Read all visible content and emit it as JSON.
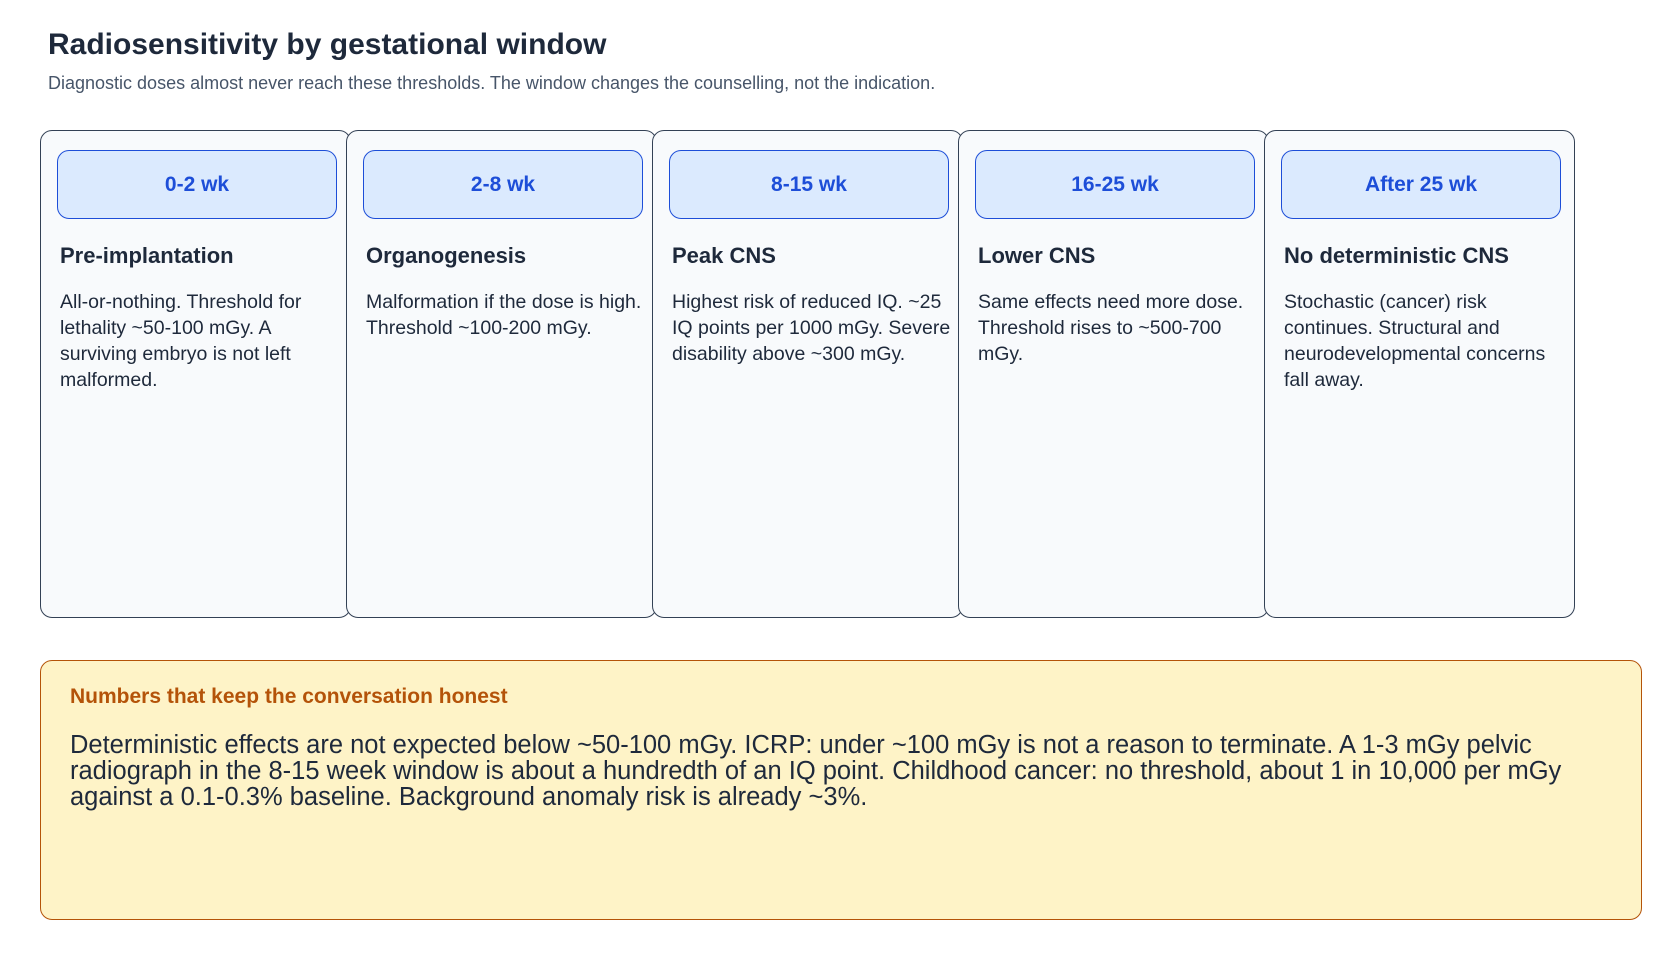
{
  "header": {
    "title": "Radiosensitivity by gestational window",
    "subtitle": "Diagnostic doses almost never reach these thresholds. The window changes the counselling, not the indication."
  },
  "windows": [
    {
      "tab": "0-2 wk",
      "heading": "Pre-implantation",
      "body": "All-or-nothing. Threshold for lethality ~50-100 mGy. A surviving embryo is not left malformed."
    },
    {
      "tab": "2-8 wk",
      "heading": "Organogenesis",
      "body": "Malformation if the dose is high. Threshold ~100-200 mGy."
    },
    {
      "tab": "8-15 wk",
      "heading": "Peak CNS",
      "body": "Highest risk of reduced IQ. ~25 IQ points per 1000 mGy. Severe disability above ~300 mGy."
    },
    {
      "tab": "16-25 wk",
      "heading": "Lower CNS",
      "body": "Same effects need more dose. Threshold rises to ~500-700 mGy."
    },
    {
      "tab": "After 25 wk",
      "heading": "No deterministic CNS",
      "body": "Stochastic (cancer) risk continues. Structural and neurodevelopmental concerns fall away."
    }
  ],
  "note": {
    "heading": "Numbers that keep the conversation honest",
    "body": "Deterministic effects are not expected below ~50-100 mGy. ICRP: under ~100 mGy is not a reason to terminate. A 1-3 mGy pelvic radiograph in the 8-15 week window is about a hundredth of an IQ point. Childhood cancer: no threshold, about 1 in 10,000 per mGy against a 0.1-0.3% baseline. Background anomaly risk is already ~3%."
  },
  "colors": {
    "card_border": "#334155",
    "card_fill": "#f8fafc",
    "tab_fill": "#dbeafe",
    "tab_accent": "#1d4ed8",
    "note_fill": "#fef3c7",
    "note_accent": "#b45309"
  }
}
